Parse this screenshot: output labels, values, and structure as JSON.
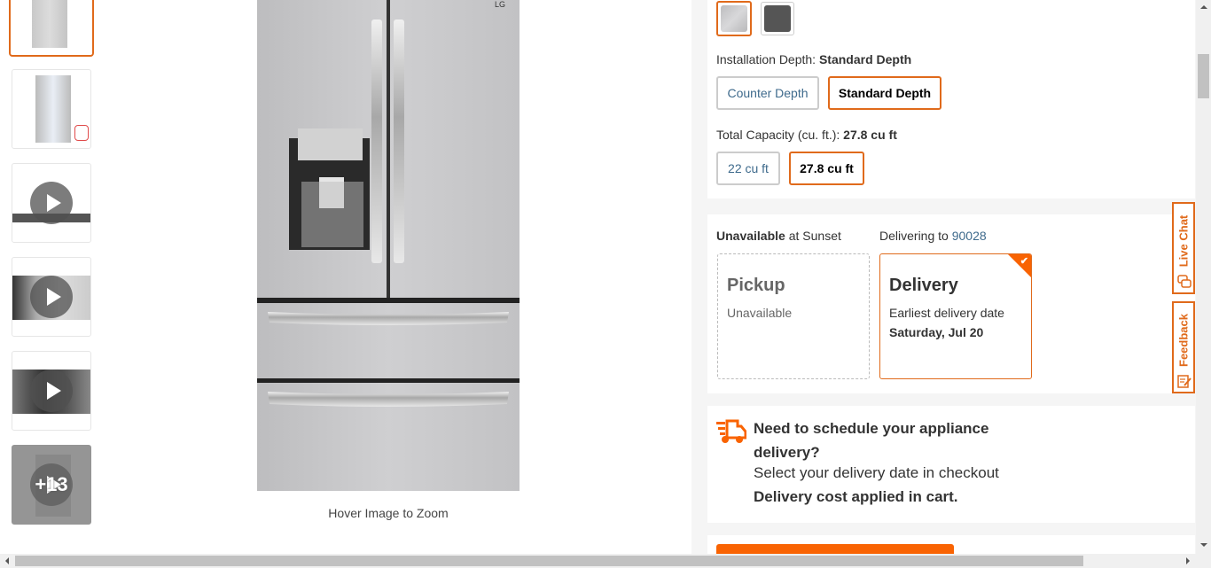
{
  "gallery": {
    "thumbnails": [
      {
        "type": "image",
        "name": "front-closed",
        "selected": true
      },
      {
        "type": "image",
        "name": "front-open",
        "selected": false
      },
      {
        "type": "video",
        "name": "video-1",
        "selected": false
      },
      {
        "type": "video",
        "name": "video-2",
        "selected": false
      },
      {
        "type": "video",
        "name": "video-3",
        "selected": false
      },
      {
        "type": "more",
        "name": "more-images",
        "label": "+13",
        "selected": false
      }
    ],
    "main_image_alt": "LG stainless steel 4-door French door refrigerator",
    "brand_logo": "LG",
    "hover_text": "Hover Image to Zoom"
  },
  "options": {
    "colors": [
      {
        "name": "Stainless Steel",
        "hex": "#c4c4c6",
        "selected": true
      },
      {
        "name": "Black Stainless",
        "hex": "#555555",
        "selected": false
      }
    ],
    "installation_depth": {
      "label": "Installation Depth:",
      "value": "Standard Depth",
      "choices": [
        {
          "label": "Counter Depth",
          "selected": false
        },
        {
          "label": "Standard Depth",
          "selected": true
        }
      ]
    },
    "capacity": {
      "label": "Total Capacity (cu. ft.):",
      "value": "27.8 cu ft",
      "choices": [
        {
          "label": "22 cu ft",
          "selected": false
        },
        {
          "label": "27.8 cu ft",
          "selected": true
        }
      ]
    }
  },
  "fulfillment": {
    "store_status": "Unavailable",
    "store_text": "at Sunset",
    "delivering_to_label": "Delivering to",
    "zip": "90028",
    "pickup": {
      "title": "Pickup",
      "status": "Unavailable"
    },
    "delivery": {
      "title": "Delivery",
      "subtitle": "Earliest delivery date",
      "date": "Saturday, Jul 20",
      "selected": true
    }
  },
  "schedule": {
    "title": "Need to schedule your appliance delivery?",
    "subtitle": "Select your delivery date in checkout",
    "cost_note": "Delivery cost applied in cart."
  },
  "side_tabs": {
    "live_chat": "Live Chat",
    "feedback": "Feedback"
  },
  "colors": {
    "accent": "#f96302",
    "border_accent": "#e06a1b",
    "link": "#3e6a8c"
  }
}
